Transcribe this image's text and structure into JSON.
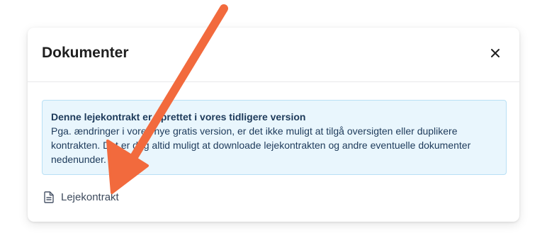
{
  "modal": {
    "title": "Dokumenter",
    "close_icon": "close-icon"
  },
  "alert": {
    "title": "Denne lejekontrakt er oprettet i vores tidligere version",
    "body": "Pga. ændringer i vores nye gratis version, er det ikke muligt at tilgå oversigten eller duplikere kontrakten. Det er dog altid muligt at downloade lejekontrakten og andre eventuelle dokumenter nedenunder."
  },
  "documents": [
    {
      "label": "Lejekontrakt",
      "icon": "document-icon"
    }
  ],
  "colors": {
    "annotation_arrow": "#f26a3d",
    "alert_background": "#e9f6fd",
    "alert_border": "#b9e0f5",
    "alert_text": "#1d3a5a"
  }
}
